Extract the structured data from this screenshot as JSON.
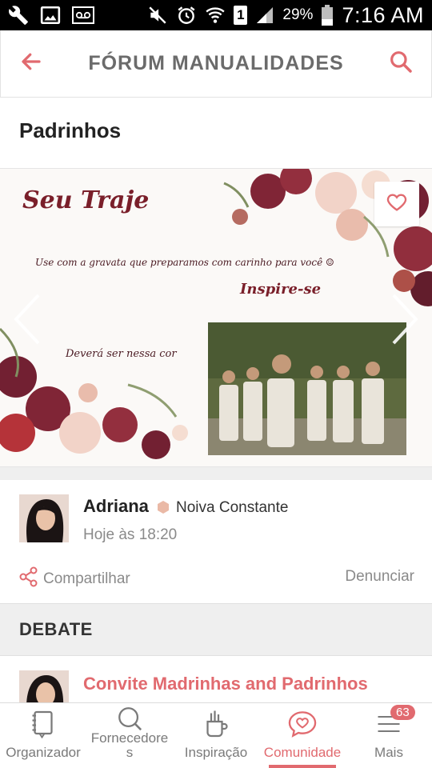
{
  "status_bar": {
    "battery_pct": "29%",
    "time": "7:16 AM",
    "sim_slot": "1",
    "icons": [
      "wrench-icon",
      "image-icon",
      "voicemail-icon",
      "mute-icon",
      "alarm-icon",
      "wifi-icon",
      "sim-icon",
      "signal-icon",
      "battery-icon"
    ]
  },
  "appbar": {
    "title": "FÓRUM MANUALIDADES",
    "back_icon": "arrow-left-icon",
    "search_icon": "search-icon",
    "accent": "#e16a6f"
  },
  "topic": {
    "title": "Padrinhos"
  },
  "photo": {
    "heading": "Seu Traje",
    "line1": "Use com a gravata que preparamos com carinho para você ☺",
    "heading2": "Inspire-se",
    "line2": "Deverá ser nessa cor",
    "fav_icon": "heart-icon"
  },
  "author": {
    "name": "Adriana",
    "role": "Noiva Constante",
    "time": "Hoje às 18:20",
    "share_label": "Compartilhar",
    "report_label": "Denunciar"
  },
  "debate": {
    "header": "DEBATE",
    "items": [
      {
        "title": "Convite Madrinhas and Padrinhos"
      }
    ]
  },
  "bottom_nav": {
    "items": [
      {
        "label": "Organizador",
        "icon": "notebook-icon"
      },
      {
        "label": "Fornecedore\ns",
        "icon": "search-icon"
      },
      {
        "label": "Inspiração",
        "icon": "brush-cup-icon"
      },
      {
        "label": "Comunidade",
        "icon": "chat-heart-icon",
        "active": true
      },
      {
        "label": "Mais",
        "icon": "menu-icon",
        "badge": "63"
      }
    ]
  }
}
